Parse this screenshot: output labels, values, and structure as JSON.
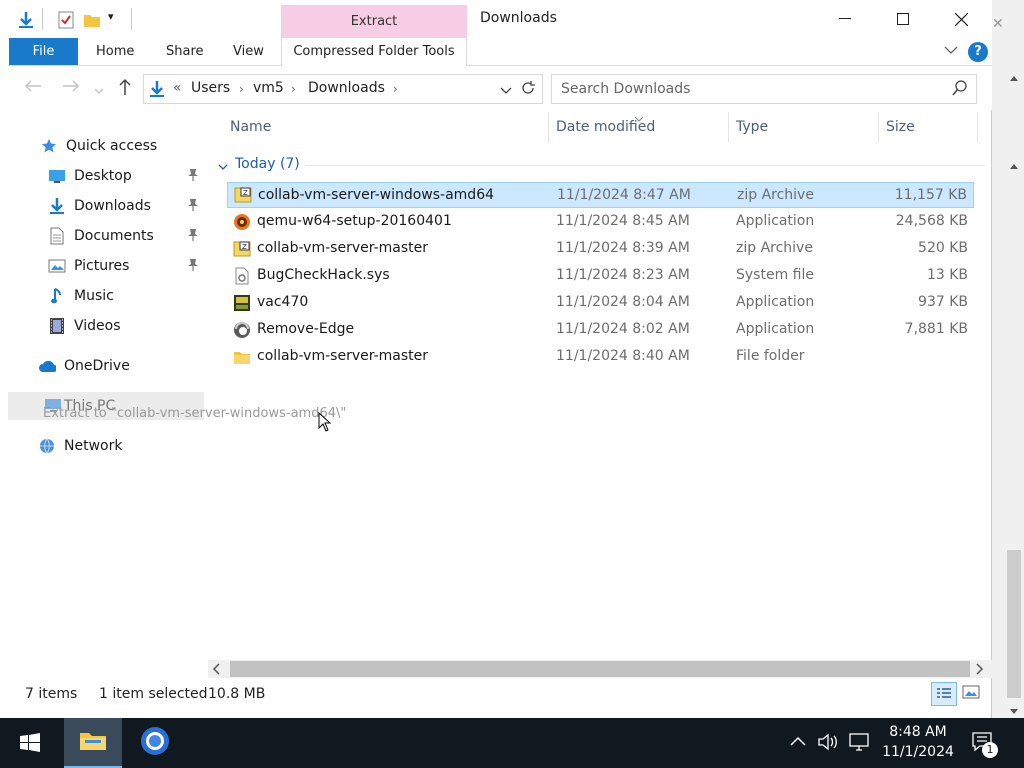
{
  "window": {
    "title": "Downloads"
  },
  "ribbon": {
    "context_tab": "Extract",
    "file_tab": "File",
    "tabs": [
      "Home",
      "Share",
      "View"
    ],
    "compressed_tab": "Compressed Folder Tools",
    "help_label": "?"
  },
  "nav": {
    "breadcrumbs": [
      "Users",
      "vm5",
      "Downloads"
    ],
    "overflow": "«",
    "search_placeholder": "Search Downloads"
  },
  "columns": {
    "name": "Name",
    "date": "Date modified",
    "type": "Type",
    "size": "Size"
  },
  "sidebar": {
    "quick_access": "Quick access",
    "items": [
      {
        "label": "Desktop",
        "icon": "desktop-icon",
        "pinned": true
      },
      {
        "label": "Downloads",
        "icon": "downloads-icon",
        "pinned": true
      },
      {
        "label": "Documents",
        "icon": "documents-icon",
        "pinned": true
      },
      {
        "label": "Pictures",
        "icon": "pictures-icon",
        "pinned": true
      },
      {
        "label": "Music",
        "icon": "music-icon",
        "pinned": false
      },
      {
        "label": "Videos",
        "icon": "videos-icon",
        "pinned": false
      }
    ],
    "onedrive": "OneDrive",
    "this_pc": "This PC",
    "network": "Network"
  },
  "group": {
    "label": "Today (7)"
  },
  "files": [
    {
      "name": "collab-vm-server-windows-amd64",
      "date": "11/1/2024 8:47 AM",
      "type": "zip Archive",
      "size": "11,157 KB",
      "icon": "zip-icon",
      "selected": true
    },
    {
      "name": "qemu-w64-setup-20160401",
      "date": "11/1/2024 8:45 AM",
      "type": "Application",
      "size": "24,568 KB",
      "icon": "installer-icon",
      "selected": false
    },
    {
      "name": "collab-vm-server-master",
      "date": "11/1/2024 8:39 AM",
      "type": "zip Archive",
      "size": "520 KB",
      "icon": "zip-icon",
      "selected": false
    },
    {
      "name": "BugCheckHack.sys",
      "date": "11/1/2024 8:23 AM",
      "type": "System file",
      "size": "13 KB",
      "icon": "system-file-icon",
      "selected": false
    },
    {
      "name": "vac470",
      "date": "11/1/2024 8:04 AM",
      "type": "Application",
      "size": "937 KB",
      "icon": "app-icon",
      "selected": false
    },
    {
      "name": "Remove-Edge",
      "date": "11/1/2024 8:02 AM",
      "type": "Application",
      "size": "7,881 KB",
      "icon": "edge-icon",
      "selected": false
    },
    {
      "name": "collab-vm-server-master",
      "date": "11/1/2024 8:40 AM",
      "type": "File folder",
      "size": "",
      "icon": "folder-icon",
      "selected": false
    }
  ],
  "drag": {
    "tooltip": "Extract to \"collab-vm-server-windows-amd64\\\""
  },
  "status": {
    "items": "7 items",
    "selected": "1 item selected",
    "size": "10.8 MB"
  },
  "taskbar": {
    "time": "8:48 AM",
    "date": "11/1/2024",
    "notifications": "1"
  },
  "colors": {
    "accent": "#1979ca",
    "selection": "#cce8ff",
    "context_tab": "#f7cde6",
    "taskbar": "#101820"
  }
}
